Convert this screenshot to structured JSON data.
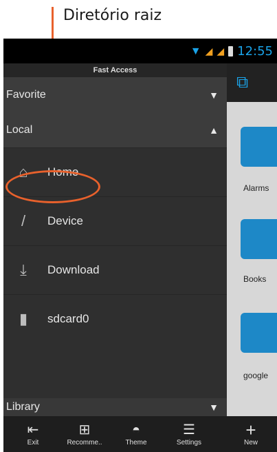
{
  "annotation": {
    "label": "Diretório raiz"
  },
  "status": {
    "time": "12:55"
  },
  "drawer": {
    "header": "Fast Access",
    "sections": [
      {
        "label": "Favorite"
      },
      {
        "label": "Local"
      },
      {
        "label": "Library"
      }
    ],
    "local_items": [
      {
        "label": "Home",
        "icon": "home-icon"
      },
      {
        "label": "Device",
        "icon": "slash-icon"
      },
      {
        "label": "Download",
        "icon": "download-icon"
      },
      {
        "label": "sdcard0",
        "icon": "sdcard-icon"
      }
    ]
  },
  "folders": [
    {
      "label": "Alarms"
    },
    {
      "label": "Books"
    },
    {
      "label": "google"
    }
  ],
  "toolbar": [
    {
      "label": "Exit",
      "icon": "exit-icon"
    },
    {
      "label": "Recomme..",
      "icon": "gift-icon"
    },
    {
      "label": "Theme",
      "icon": "theme-icon"
    },
    {
      "label": "Settings",
      "icon": "settings-icon"
    },
    {
      "label": "New",
      "icon": "plus-icon"
    }
  ],
  "colors": {
    "annotation": "#e8612c",
    "accent": "#1aa3e8",
    "folder": "#1d88c7"
  }
}
